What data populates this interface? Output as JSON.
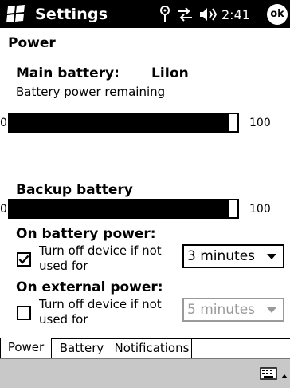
{
  "titlebar": {
    "app_title": "Settings",
    "time": "2:41",
    "ok_label": "ok"
  },
  "page": {
    "title": "Power"
  },
  "main_battery": {
    "label": "Main battery:",
    "type": "LiIon",
    "subtitle": "Battery power remaining",
    "min": "0",
    "max": "100",
    "level": 0.96
  },
  "backup_battery": {
    "label": "Backup battery",
    "min": "0",
    "max": "100",
    "level": 0.96
  },
  "on_battery": {
    "heading": "On battery power:",
    "checkbox_line1": "Turn off device if not",
    "checkbox_line2": "used for",
    "checked": true,
    "selected_value": "3 minutes"
  },
  "on_external": {
    "heading": "On external power:",
    "checkbox_line1": "Turn off device if not",
    "checkbox_line2": "used for",
    "checked": false,
    "selected_value": "5 minutes"
  },
  "tabs": [
    {
      "label": "Power",
      "active": true
    },
    {
      "label": "Battery",
      "active": false
    },
    {
      "label": "Notifications",
      "active": false
    }
  ],
  "icons": {
    "start": "windows-flag-icon",
    "signal": "antenna-icon",
    "connectivity": "sync-arrows-icon",
    "volume": "speaker-icon",
    "keyboard": "keyboard-icon",
    "sip": "up-arrow-icon"
  }
}
